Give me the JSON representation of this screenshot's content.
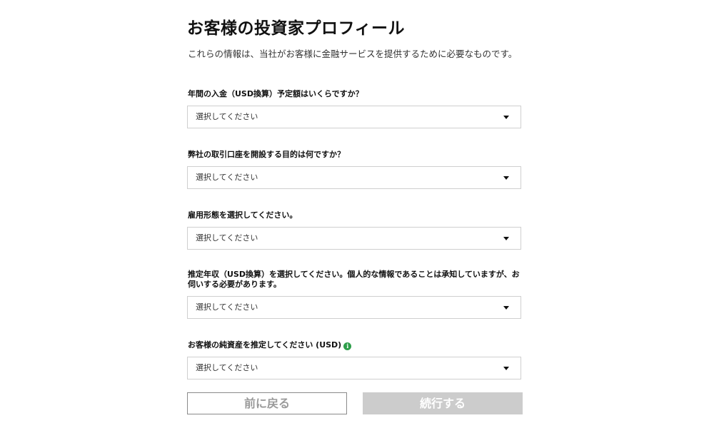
{
  "header": {
    "title": "お客様の投資家プロフィール",
    "subtitle": "これらの情報は、当社がお客様に金融サービスを提供するために必要なものです。"
  },
  "fields": [
    {
      "label": "年間の入金（USD換算）予定額はいくらですか？",
      "placeholder": "選択してください"
    },
    {
      "label": "弊社の取引口座を開設する目的は何ですか？",
      "placeholder": "選択してください"
    },
    {
      "label": "雇用形態を選択してください。",
      "placeholder": "選択してください"
    },
    {
      "label": "推定年収（USD換算）を選択してください。個人的な情報であることは承知していますが、お伺いする必要があります。",
      "placeholder": "選択してください"
    },
    {
      "label": "お客様の純資産を推定してください (USD)",
      "placeholder": "選択してください",
      "info_icon": "info-icon",
      "info_icon_color": "#2e9e4a"
    }
  ],
  "buttons": {
    "back_label": "前に戻る",
    "continue_label": "続行する"
  }
}
